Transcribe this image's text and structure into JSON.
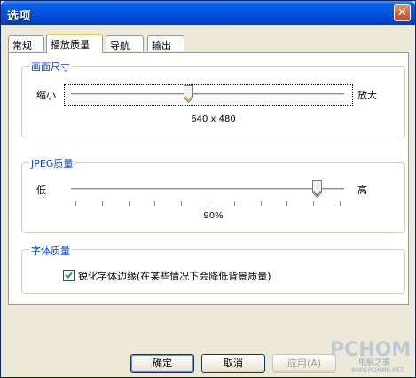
{
  "window": {
    "title": "选项",
    "close_label": "✕"
  },
  "tabs": [
    {
      "label": "常规",
      "active": false
    },
    {
      "label": "播放质量",
      "active": true
    },
    {
      "label": "导航",
      "active": false
    },
    {
      "label": "输出",
      "active": false
    }
  ],
  "picture_size": {
    "legend": "画面尺寸",
    "min_label": "缩小",
    "max_label": "放大",
    "slider_value": 0.43,
    "value_text": "640 x 480"
  },
  "jpeg_quality": {
    "legend": "JPEG质量",
    "min_label": "低",
    "max_label": "高",
    "slider_value": 0.9,
    "value_text": "90%",
    "tick_count": 11
  },
  "font_quality": {
    "legend": "字体质量",
    "checkbox_label": "锐化字体边缘(在某些情况下会降低背景质量)",
    "checked": true
  },
  "buttons": {
    "ok": "确定",
    "cancel": "取消",
    "apply": "应用(A)"
  },
  "watermark": {
    "line1": "PCHOME",
    "line2": "电脑之家",
    "line3": "WWW.PCHOME.NET"
  },
  "colors": {
    "title_bar": "#0054e3",
    "legend_text": "#0046d5",
    "dialog_bg": "#ece9d8"
  }
}
